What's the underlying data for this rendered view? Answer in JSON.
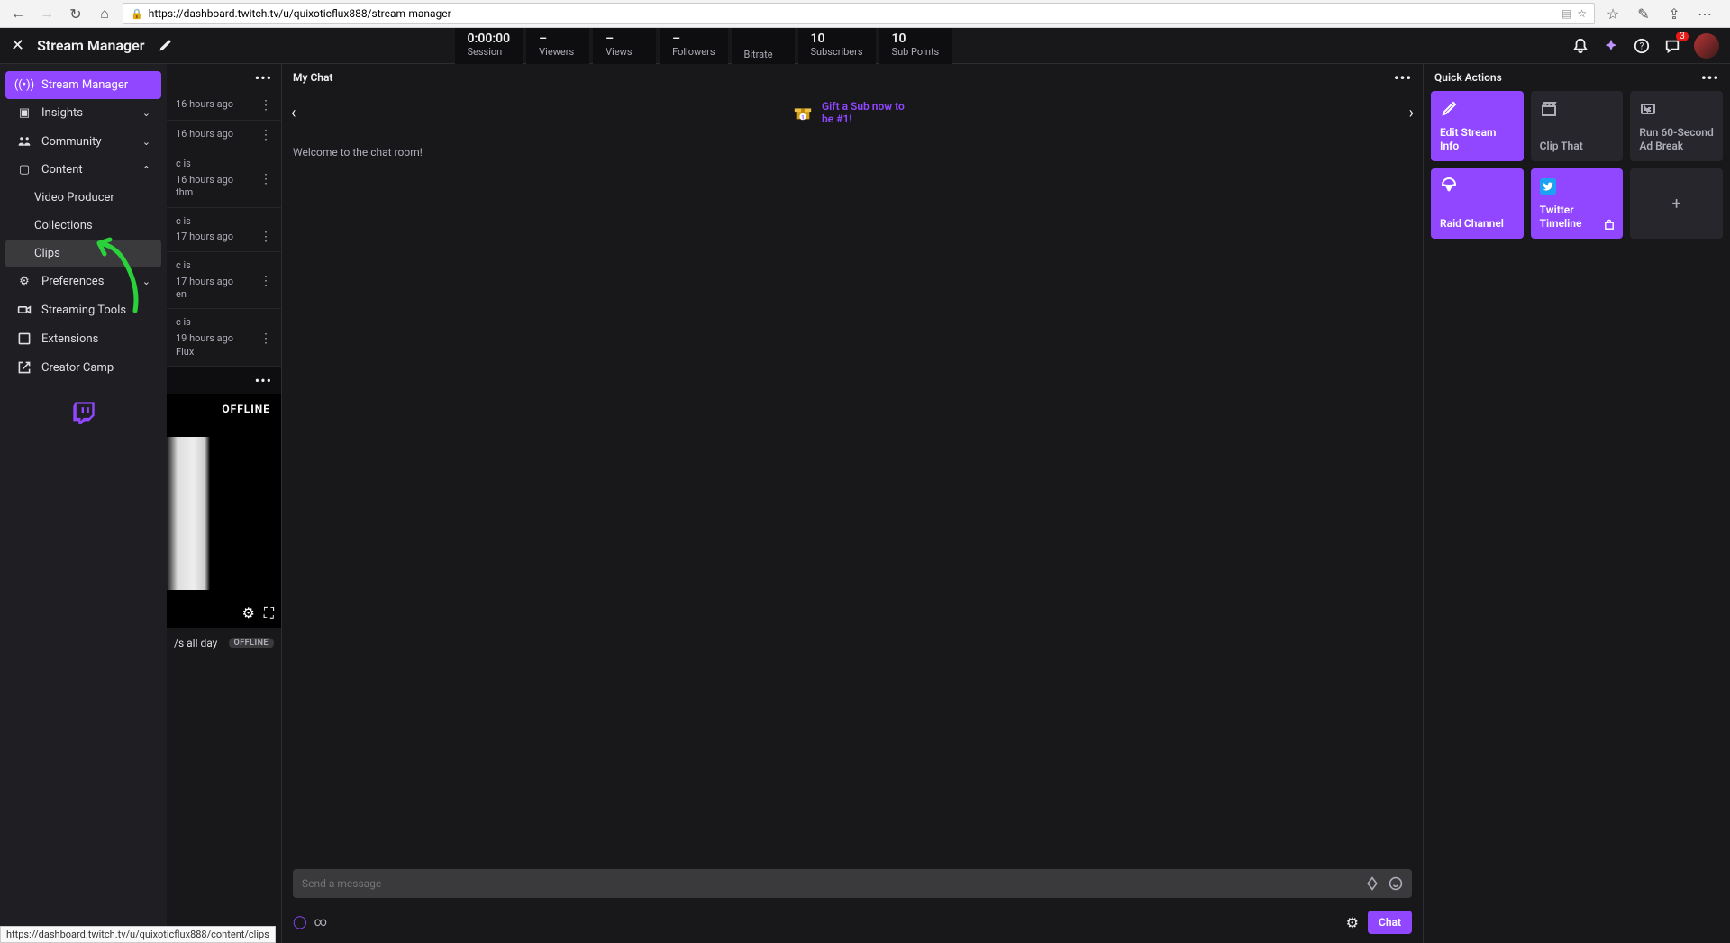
{
  "browser": {
    "url": "https://dashboard.twitch.tv/u/quixoticflux888/stream-manager",
    "status_url": "https://dashboard.twitch.tv/u/quixoticflux888/content/clips"
  },
  "header": {
    "title": "Stream Manager",
    "stats": {
      "session": {
        "val": "0:00:00",
        "lbl": "Session"
      },
      "viewers": {
        "val": "–",
        "lbl": "Viewers"
      },
      "views": {
        "val": "–",
        "lbl": "Views"
      },
      "followers": {
        "val": "–",
        "lbl": "Followers"
      },
      "bitrate": {
        "val": "",
        "lbl": "Bitrate"
      },
      "subscribers": {
        "val": "10",
        "lbl": "Subscribers"
      },
      "subpoints": {
        "val": "10",
        "lbl": "Sub Points"
      }
    },
    "notif_badge": "3"
  },
  "sidebar": {
    "items": [
      {
        "label": "Stream Manager",
        "icon": "broadcast",
        "active": true
      },
      {
        "label": "Insights",
        "icon": "insights",
        "chev": "down"
      },
      {
        "label": "Community",
        "icon": "community",
        "chev": "down"
      },
      {
        "label": "Content",
        "icon": "content",
        "chev": "up"
      }
    ],
    "content_sub": [
      {
        "label": "Video Producer"
      },
      {
        "label": "Collections"
      },
      {
        "label": "Clips"
      }
    ],
    "items2": [
      {
        "label": "Preferences",
        "icon": "gear",
        "chev": "down"
      },
      {
        "label": "Streaming Tools",
        "icon": "camera"
      },
      {
        "label": "Extensions",
        "icon": "puzzle"
      },
      {
        "label": "Creator Camp",
        "icon": "external"
      }
    ]
  },
  "activity": {
    "items": [
      {
        "time": "16 hours ago",
        "txt": ""
      },
      {
        "time": "16 hours ago",
        "txt": ""
      },
      {
        "time": "16 hours ago",
        "txt": "c is",
        "txt2": "thm"
      },
      {
        "time": "17 hours ago",
        "txt": "c is"
      },
      {
        "time": "17 hours ago",
        "txt": "c is",
        "txt2": "en"
      },
      {
        "time": "19 hours ago",
        "txt": "c is",
        "txt2": "Flux"
      }
    ],
    "offline": "OFFLINE",
    "stream_title": "/s all day",
    "offline_pill": "OFFLINE"
  },
  "chat": {
    "header": "My Chat",
    "gift_text": "Gift a Sub now to be #1!",
    "welcome": "Welcome to the chat room!",
    "placeholder": "Send a message",
    "send": "Chat",
    "infinity": "∞"
  },
  "quick_actions": {
    "header": "Quick Actions",
    "cards": [
      {
        "label": "Edit Stream Info",
        "type": "purple",
        "icon": "pencil"
      },
      {
        "label": "Clip That",
        "type": "dark",
        "icon": "clapper"
      },
      {
        "label": "Run 60-Second Ad Break",
        "type": "dark",
        "icon": "ad"
      },
      {
        "label": "Raid Channel",
        "type": "purple",
        "icon": "parachute"
      },
      {
        "label": "Twitter Timeline",
        "type": "purple",
        "icon": "twitter",
        "ext": true
      },
      {
        "label": "+",
        "type": "add"
      }
    ]
  }
}
